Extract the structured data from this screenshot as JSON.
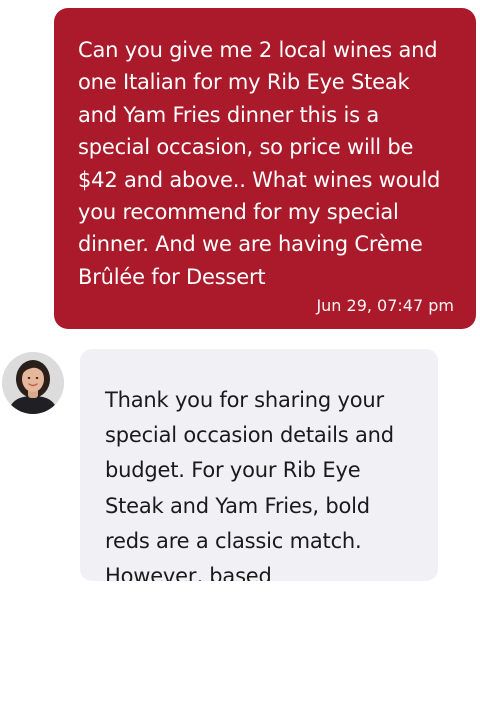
{
  "conversation": {
    "user_message": {
      "text": "Can you give me 2 local wines and one Italian for my Rib Eye Steak and Yam Fries dinner this is a special occasion, so price will be $42 and above.. What wines would you recommend for my special dinner. And we are having Crème Brûlée for Dessert",
      "timestamp": "Jun 29, 07:47 pm",
      "bubble_color": "#aa1a2b"
    },
    "assistant_message": {
      "text": "Thank you for sharing your special occasion details and budget. For your Rib Eye Steak and Yam Fries, bold reds are a classic match. However, based",
      "avatar": "assistant-avatar-photo",
      "bubble_color": "#f1f1f5"
    }
  }
}
